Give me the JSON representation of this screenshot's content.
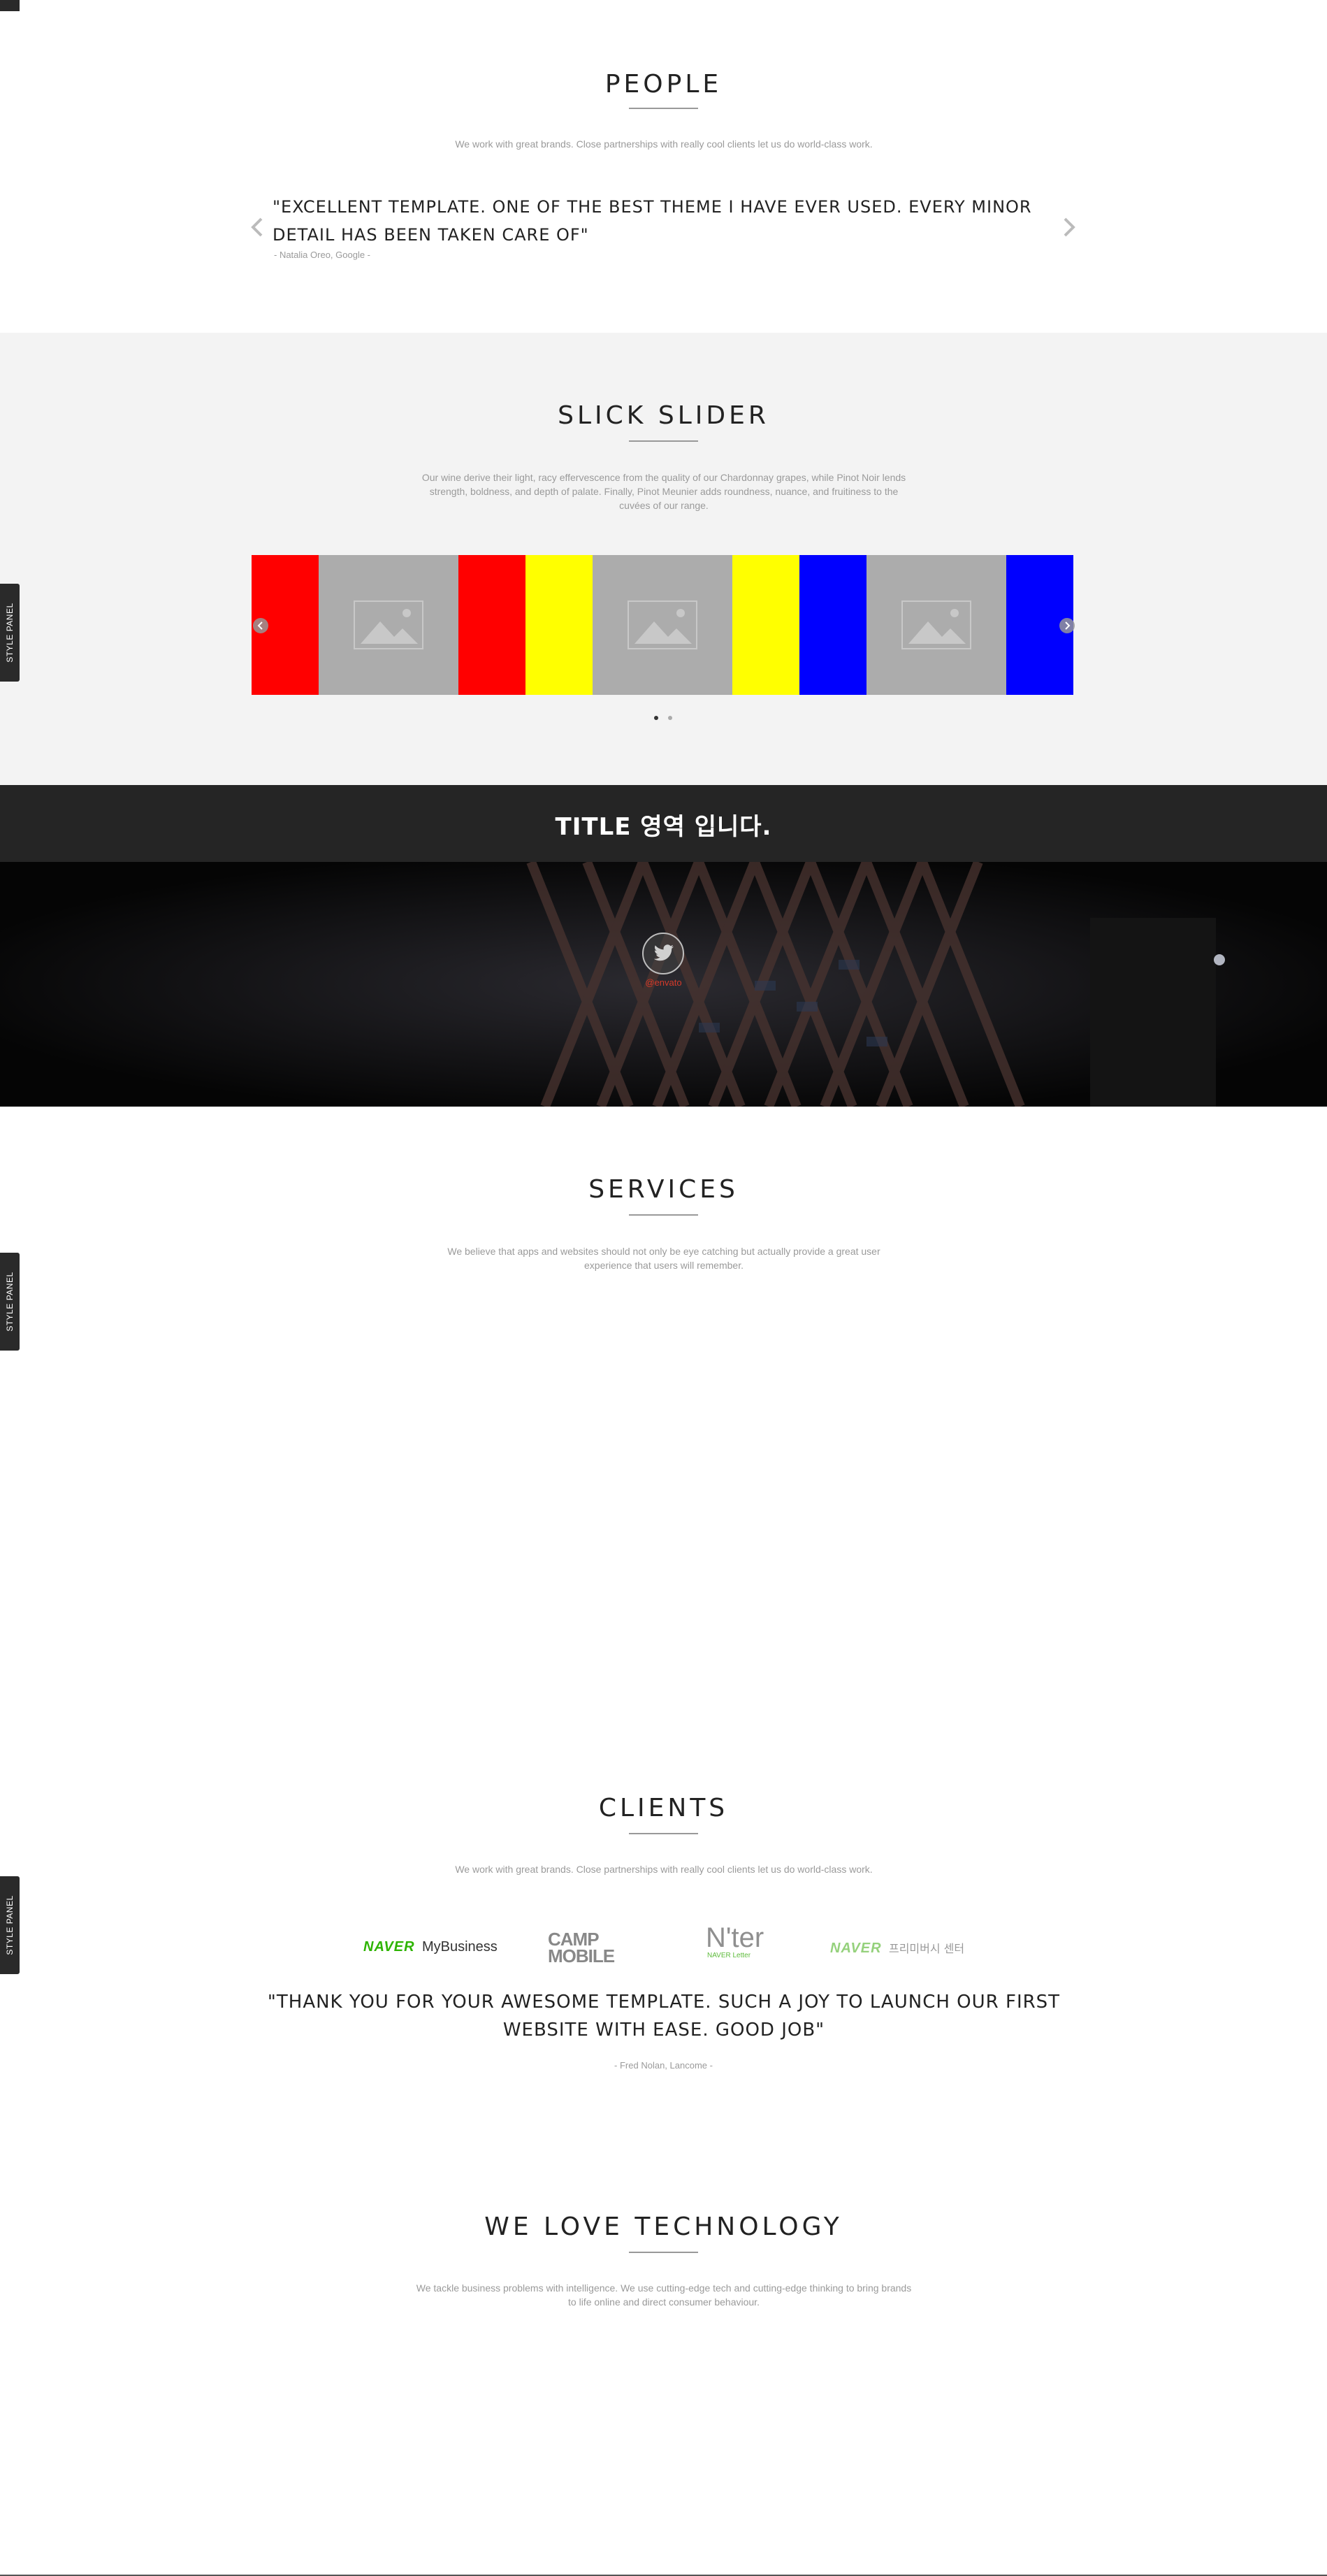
{
  "people": {
    "title": "PEOPLE",
    "subtitle": "We work with great brands. Close partnerships with really cool clients let us do world-class work.",
    "testimonial": "\"EXCELLENT TEMPLATE. ONE OF THE BEST THEME I HAVE EVER USED. EVERY MINOR DETAIL HAS BEEN TAKEN CARE OF\"",
    "author": "- Natalia Oreo, Google -"
  },
  "slick": {
    "title": "SLICK SLIDER",
    "subtitle": "Our wine derive their light, racy effervescence from the quality of our Chardonnay grapes, while Pinot Noir lends strength, boldness, and depth of palate. Finally, Pinot Meunier adds roundness, nuance, and fruitiness to the cuvées of our range.",
    "slides": [
      "red",
      "placeholder",
      "red",
      "yellow",
      "placeholder",
      "yellow",
      "blue",
      "placeholder",
      "blue"
    ],
    "colors": {
      "red": "#ff0000",
      "yellow": "#ffff00",
      "blue": "#0000ff",
      "placeholder": "#acacac"
    },
    "dots": [
      {
        "active": true
      },
      {
        "active": false
      }
    ]
  },
  "style_panel": {
    "label": "STYLE PANEL"
  },
  "banner": {
    "title": "TITLE 영역 입니다.",
    "handle": "@envato"
  },
  "services": {
    "title": "SERVICES",
    "subtitle": "We believe that apps and websites should not only be eye catching but actually provide a great user experience that users will remember."
  },
  "clients": {
    "title": "CLIENTS",
    "subtitle": "We work with great brands. Close partnerships with really cool clients let us do world-class work.",
    "logos": {
      "naver1_brand": "NAVER",
      "naver1_product": "MyBusiness",
      "camp_line1": "CAMP",
      "camp_line2": "MOBILE",
      "nter_main": "N'ter",
      "nter_sub": "NAVER Letter",
      "naver2_brand": "NAVER",
      "naver2_product": "프리미버시 센터"
    },
    "testimonial": "\"THANK YOU FOR YOUR AWESOME TEMPLATE. SUCH A JOY TO LAUNCH OUR FIRST WEBSITE WITH EASE. GOOD JOB\"",
    "author": "- Fred Nolan, Lancome -"
  },
  "technology": {
    "title": "WE LOVE TECHNOLOGY",
    "subtitle": "We tackle business problems with intelligence. We use cutting-edge tech and cutting-edge thinking to bring brands to life online and direct consumer behaviour."
  }
}
